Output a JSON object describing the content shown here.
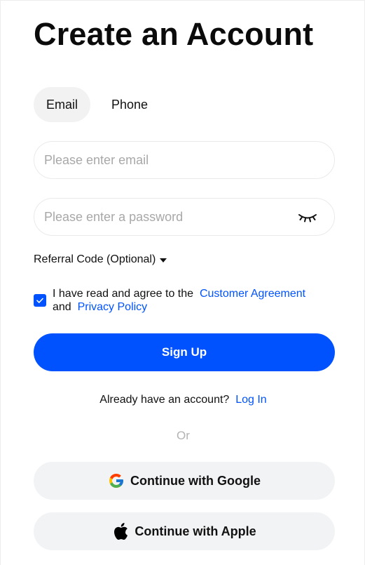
{
  "page": {
    "title": "Create an Account"
  },
  "tabs": [
    {
      "label": "Email",
      "active": true
    },
    {
      "label": "Phone",
      "active": false
    }
  ],
  "email_field": {
    "placeholder": "Please enter email",
    "value": ""
  },
  "password_field": {
    "placeholder": "Please enter a password",
    "value": "",
    "visibility_icon": "eye-closed-icon"
  },
  "referral": {
    "label": "Referral Code (Optional)",
    "icon": "caret-down-icon"
  },
  "agreement": {
    "checked": true,
    "text_prefix": "I have read and agree to the",
    "customer_agreement_link": "Customer Agreement",
    "conjunction": "and",
    "privacy_policy_link": "Privacy Policy"
  },
  "signup_button": {
    "label": "Sign Up"
  },
  "login_prompt": {
    "text": "Already have an account?",
    "link": "Log In"
  },
  "divider": {
    "text": "Or"
  },
  "social": {
    "google_label": "Continue with Google",
    "google_icon": "google-icon",
    "apple_label": "Continue with Apple",
    "apple_icon": "apple-icon"
  },
  "colors": {
    "accent": "#0052ff",
    "input_border": "#eaeaea",
    "secondary_bg": "#f2f3f5",
    "placeholder": "#a8a8a8"
  }
}
